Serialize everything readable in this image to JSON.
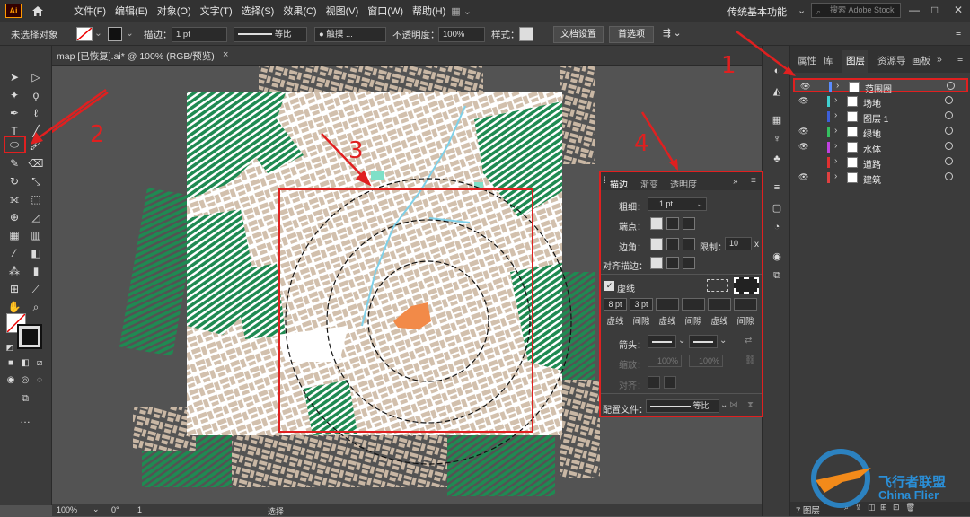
{
  "app": {
    "logo": "Ai",
    "menus": [
      "文件(F)",
      "编辑(E)",
      "对象(O)",
      "文字(T)",
      "选择(S)",
      "效果(C)",
      "视图(V)",
      "窗口(W)",
      "帮助(H)"
    ],
    "workspace": "传统基本功能",
    "search_placeholder": "搜索 Adobe Stock"
  },
  "control": {
    "selection": "未选择对象",
    "stroke_label": "描边：",
    "stroke_weight": "1 pt",
    "profile": "等比",
    "brush": "触摸 ...",
    "opacity_label": "不透明度：",
    "opacity": "100%",
    "style_label": "样式：",
    "doc_setup": "文档设置",
    "prefs": "首选项"
  },
  "document": {
    "tab": "map [已恢复].ai* @ 100% (RGB/预览)",
    "close": "×"
  },
  "status": {
    "zoom": "100%",
    "rotation": "0°",
    "page": "1",
    "mode": "选择"
  },
  "panels_tabs": [
    "属性",
    "库",
    "图层",
    "资源导",
    "画板"
  ],
  "layers": [
    {
      "name": "范围圈",
      "color": "#5a8cff",
      "visible": true,
      "selected": true
    },
    {
      "name": "场地",
      "color": "#40d0d0",
      "visible": true
    },
    {
      "name": "图层 1",
      "color": "#3d5fd9",
      "visible": false
    },
    {
      "name": "绿地",
      "color": "#35c060",
      "visible": true
    },
    {
      "name": "水体",
      "color": "#c040e0",
      "visible": true
    },
    {
      "name": "道路",
      "color": "#e03030",
      "visible": false
    },
    {
      "name": "建筑",
      "color": "#e04040",
      "visible": true
    }
  ],
  "layers_footer": "7 图层",
  "stroke_panel": {
    "tabs": [
      "描边",
      "渐变",
      "透明度"
    ],
    "weight_label": "粗细：",
    "weight": "1 pt",
    "cap_label": "端点：",
    "corner_label": "边角：",
    "limit_label": "限制：",
    "limit": "10",
    "limit_unit": "x",
    "align_label": "对齐描边：",
    "dashed_label": "虚线",
    "dash_values": [
      "8 pt",
      "3 pt",
      "",
      "",
      "",
      ""
    ],
    "dash_labels": [
      "虚线",
      "间隙",
      "虚线",
      "间隙",
      "虚线",
      "间隙"
    ],
    "arrow_label": "箭头：",
    "scale_label": "缩放：",
    "scale1": "100%",
    "scale2": "100%",
    "align2_label": "对齐：",
    "profile_label": "配置文件：",
    "profile": "等比"
  },
  "annotations": [
    "1",
    "2",
    "3",
    "4"
  ],
  "watermark": {
    "cn": "飞行者联盟",
    "en": "China Flier"
  }
}
